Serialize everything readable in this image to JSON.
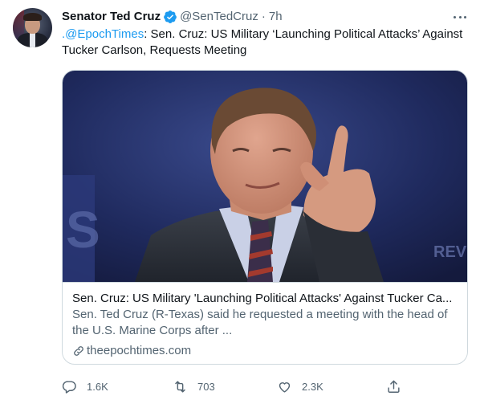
{
  "tweet": {
    "author_name": "Senator Ted Cruz",
    "handle": "@SenTedCruz",
    "separator": "·",
    "time": "7h",
    "text_mention": ".@EpochTimes",
    "text_body": ": Sen. Cruz: US Military ‘Launching Political Attacks’ Against Tucker Carlson, Requests Meeting"
  },
  "card": {
    "image_text": "S",
    "image_text_right": "REVE",
    "title": "Sen. Cruz: US Military 'Launching Political Attacks' Against Tucker Ca...",
    "description": "Sen. Ted Cruz (R-Texas) said he requested a meeting with the head of the U.S. Marine Corps after ...",
    "domain": "theepochtimes.com"
  },
  "actions": {
    "replies": "1.6K",
    "retweets": "703",
    "likes": "2.3K"
  },
  "icons": {
    "verified": "verified-badge-icon",
    "more": "more-options-icon",
    "link": "link-icon",
    "reply": "reply-icon",
    "retweet": "retweet-icon",
    "like": "heart-icon",
    "share": "share-icon"
  },
  "colors": {
    "accent": "#1d9bf0",
    "text_primary": "#0f1419",
    "text_secondary": "#536471",
    "border": "#cfd9de"
  }
}
